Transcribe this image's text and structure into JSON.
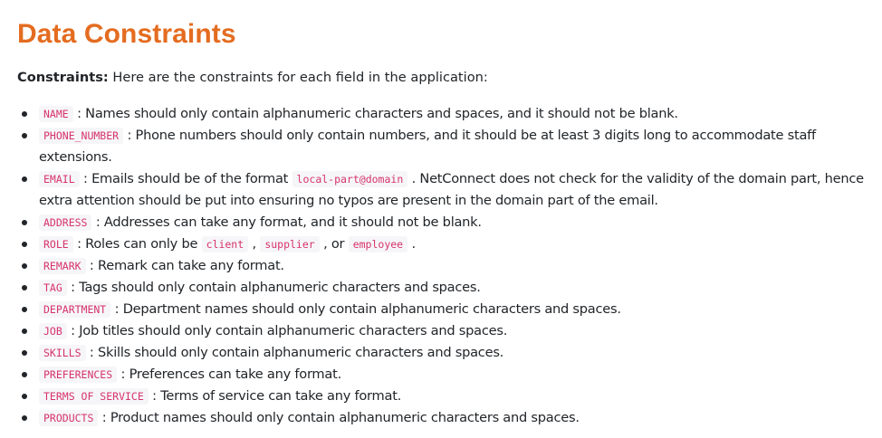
{
  "title": "Data Constraints",
  "intro": {
    "label": "Constraints:",
    "text": " Here are the constraints for each field in the application:"
  },
  "items": [
    {
      "field": "NAME",
      "text": " : Names should only contain alphanumeric characters and spaces, and it should not be blank."
    },
    {
      "field": "PHONE_NUMBER",
      "text": " : Phone numbers should only contain numbers, and it should be at least 3 digits long to accommodate staff extensions."
    },
    {
      "field": "EMAIL",
      "text_a": " : Emails should be of the format ",
      "code_a": "local-part@domain",
      "text_b": " . NetConnect does not check for the validity of the domain part, hence extra attention should be put into ensuring no typos are present in the domain part of the email."
    },
    {
      "field": "ADDRESS",
      "text": " : Addresses can take any format, and it should not be blank."
    },
    {
      "field": "ROLE",
      "text_a": " : Roles can only be ",
      "code_a": "client",
      "text_b": " , ",
      "code_b": "supplier",
      "text_c": " , or ",
      "code_c": "employee",
      "text_d": " ."
    },
    {
      "field": "REMARK",
      "text": " : Remark can take any format."
    },
    {
      "field": "TAG",
      "text": " : Tags should only contain alphanumeric characters and spaces."
    },
    {
      "field": "DEPARTMENT",
      "text": " : Department names should only contain alphanumeric characters and spaces."
    },
    {
      "field": "JOB",
      "text": " : Job titles should only contain alphanumeric characters and spaces."
    },
    {
      "field": "SKILLS",
      "text": " : Skills should only contain alphanumeric characters and spaces."
    },
    {
      "field": "PREFERENCES",
      "text": " : Preferences can take any format."
    },
    {
      "field": "TERMS OF SERVICE",
      "text": " : Terms of service can take any format."
    },
    {
      "field": "PRODUCTS",
      "text": " : Product names should only contain alphanumeric characters and spaces."
    }
  ],
  "colors": {
    "heading": "#e46c20",
    "code_text": "#d6336c",
    "code_bg": "#f6f6f8",
    "body_text": "#212529"
  }
}
